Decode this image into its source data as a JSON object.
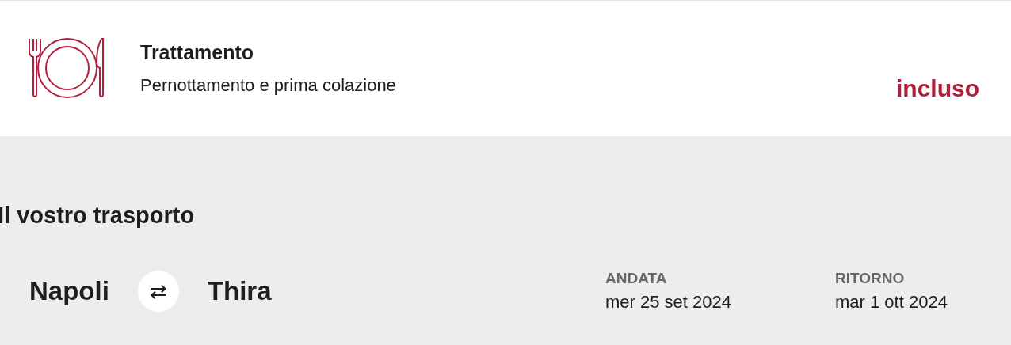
{
  "board": {
    "title": "Trattamento",
    "description": "Pernottamento e prima colazione",
    "price": "incluso"
  },
  "transport": {
    "heading": "Il vostro trasporto",
    "from": "Napoli",
    "swap": "⇄",
    "to": "Thira",
    "dates": [
      {
        "label": "ANDATA",
        "value": "mer 25 set 2024"
      },
      {
        "label": "RITORNO",
        "value": "mar 1 ott 2024"
      }
    ]
  }
}
